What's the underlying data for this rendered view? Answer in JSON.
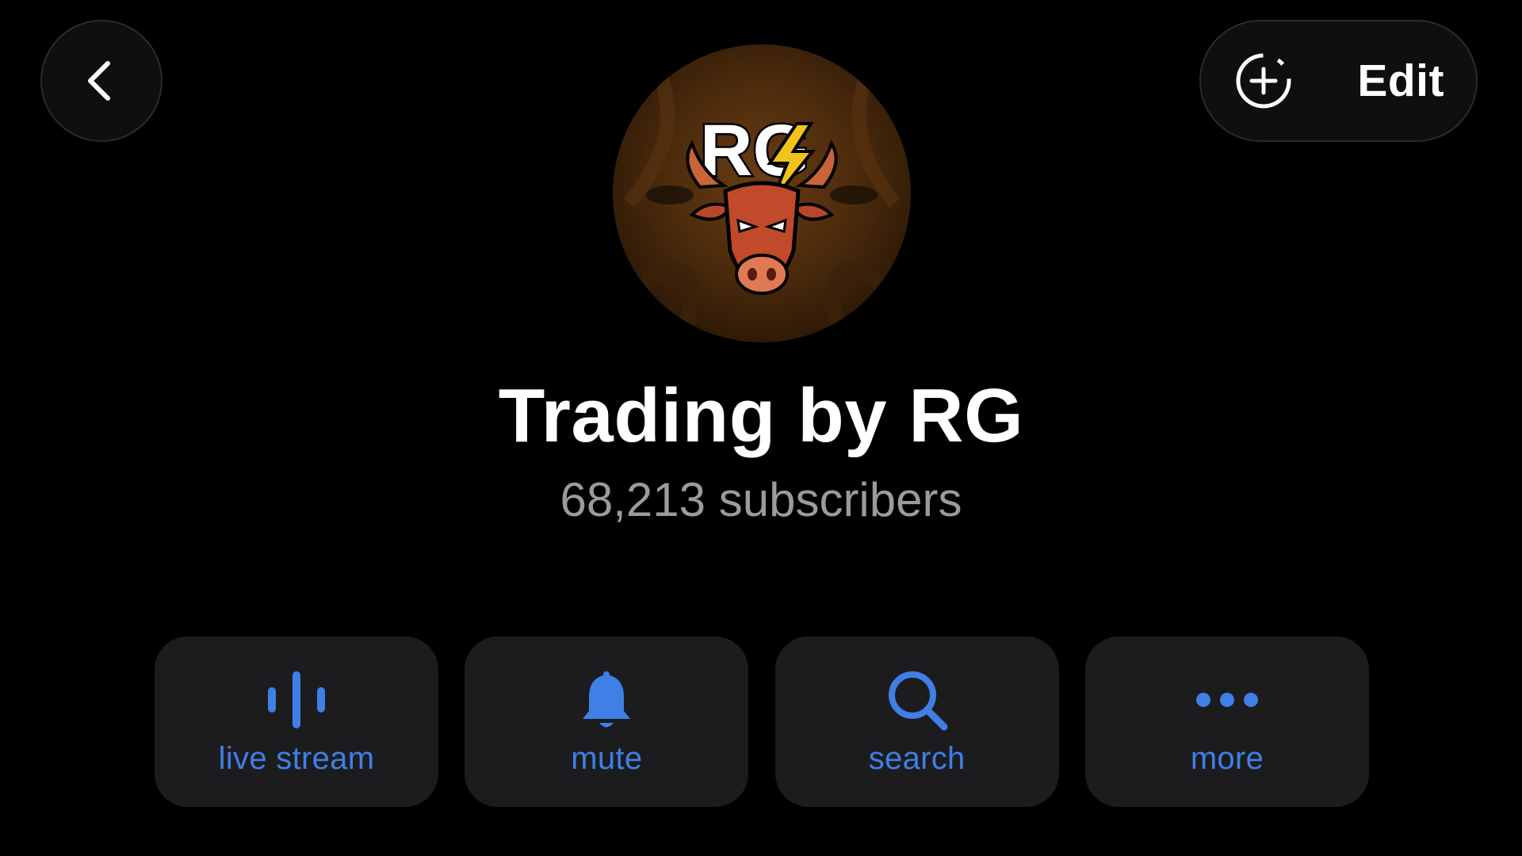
{
  "header": {
    "back_icon": "chevron-left-icon",
    "story_add_icon": "dashed-circle-plus-icon",
    "edit_label": "Edit"
  },
  "channel": {
    "avatar_text": "RG",
    "title": "Trading by RG",
    "subscribers": "68,213 subscribers"
  },
  "actions": [
    {
      "label": "live stream",
      "icon": "live-stream-waveform-icon"
    },
    {
      "label": "mute",
      "icon": "bell-icon"
    },
    {
      "label": "search",
      "icon": "search-icon"
    },
    {
      "label": "more",
      "icon": "more-dots-icon"
    }
  ],
  "colors": {
    "background": "#000000",
    "accent": "#3f7fe6",
    "card": "#1c1c1e",
    "secondary_text": "#9a9aa0"
  }
}
